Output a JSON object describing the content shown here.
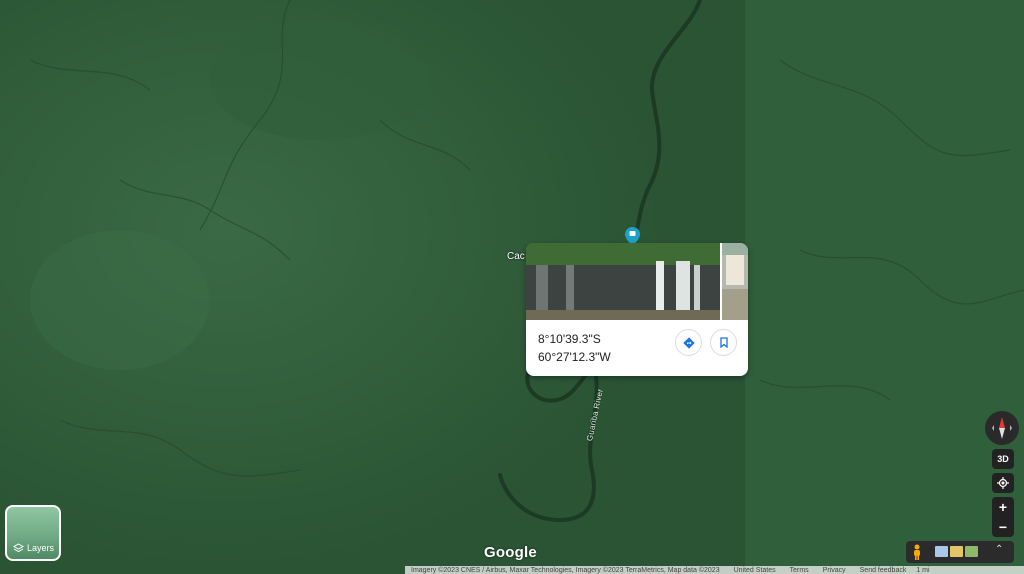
{
  "map": {
    "river_label": "Guariba River",
    "place_label_fragment": "Cac",
    "colors": {
      "forest": "#2c5a37",
      "forest_right": "#305f3b",
      "river": "#1c3a24",
      "pin": "#1aa3c8"
    }
  },
  "info_card": {
    "latitude": "8°10'39.3\"S",
    "longitude": "60°27'12.3\"W",
    "directions_icon": "directions-diamond-icon",
    "save_icon": "bookmark-icon"
  },
  "layers_button": {
    "label": "Layers"
  },
  "google_logo": "Google",
  "attribution": {
    "imagery": "Imagery ©2023 CNES / Airbus, Maxar Technologies, Imagery ©2023 TerraMetrics, Map data ©2023",
    "country": "United States",
    "terms": "Terms",
    "privacy": "Privacy",
    "feedback": "Send feedback",
    "scale": "1 mi"
  },
  "controls": {
    "three_d": "3D",
    "zoom_in": "+",
    "zoom_out": "−"
  }
}
